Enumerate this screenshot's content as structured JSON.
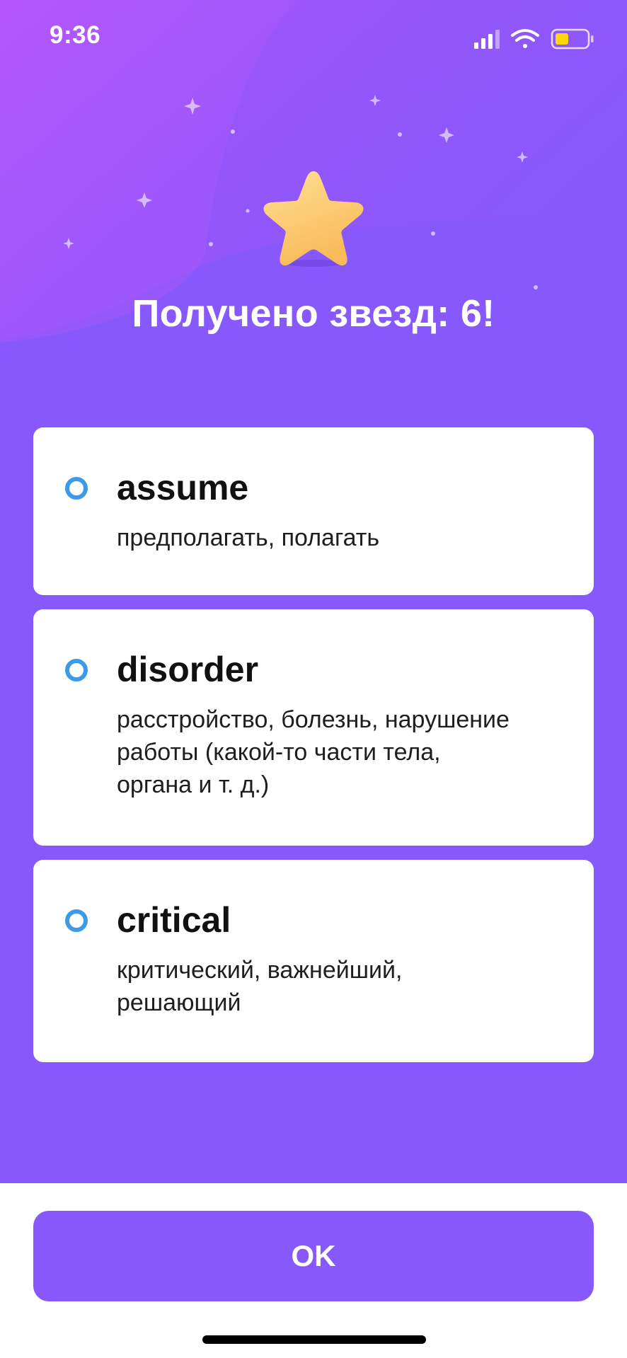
{
  "status_bar": {
    "time": "9:36",
    "icons": [
      "cellular-signal-icon",
      "wifi-icon",
      "battery-low-icon"
    ]
  },
  "header": {
    "icon": "star-icon",
    "stars_earned": "Получено звезд: 6!"
  },
  "words": [
    {
      "word": "assume",
      "translation": "предполагать, полагать"
    },
    {
      "word": "disorder",
      "translation": "расстройство, болезнь, нарушение работы (какой-то части тела, органа и т. д.)"
    },
    {
      "word": "critical",
      "translation": "критический, важнейший, решающий"
    }
  ],
  "ok_button": {
    "label": "OK"
  },
  "colors": {
    "background": "#8758fb",
    "gradient_corner": "#b558fb",
    "card": "#ffffff",
    "radio": "#3d9ae8",
    "star": "#fcc96e",
    "battery": "#ffd60a"
  }
}
